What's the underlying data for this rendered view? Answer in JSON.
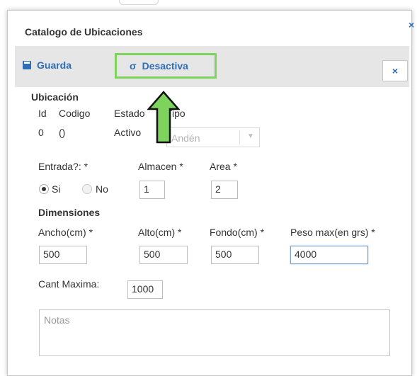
{
  "dialog": {
    "title": "Catalogo de Ubicaciones",
    "close_glyph": "×"
  },
  "toolbar": {
    "save_label": "Guarda",
    "save_icon": "save-icon",
    "deactivate_label": "Desactiva",
    "deactivate_icon": "σ",
    "close_glyph": "×",
    "highlight_color": "#7dd35c"
  },
  "ubicacion": {
    "heading": "Ubicación",
    "columns": [
      "Id",
      "Codigo",
      "Estado",
      "Tipo"
    ],
    "values": {
      "id": "0",
      "codigo": "()",
      "estado": "Activo"
    },
    "tipo_select": {
      "value": "Andén",
      "disabled": true
    }
  },
  "entrada": {
    "label": "Entrada?: *",
    "options": [
      {
        "label": "Si",
        "checked": true
      },
      {
        "label": "No",
        "checked": false
      }
    ]
  },
  "almacen": {
    "label": "Almacen *",
    "value": "1"
  },
  "area": {
    "label": "Area *",
    "value": "2"
  },
  "dimensiones": {
    "heading": "Dimensiones",
    "ancho": {
      "label": "Ancho(cm) *",
      "value": "500"
    },
    "alto": {
      "label": "Alto(cm) *",
      "value": "500"
    },
    "fondo": {
      "label": "Fondo(cm) *",
      "value": "500"
    },
    "peso": {
      "label": "Peso max(en grs) *",
      "value": "4000"
    }
  },
  "cant_maxima": {
    "label": "Cant Maxima:",
    "value": "1000"
  },
  "notas": {
    "placeholder": "Notas"
  },
  "annotation": {
    "arrow_color": "#7dd35c",
    "arrow_direction": "up"
  },
  "colors": {
    "accent": "#2f6db5",
    "toolbar_bg": "#e6e6e6"
  }
}
